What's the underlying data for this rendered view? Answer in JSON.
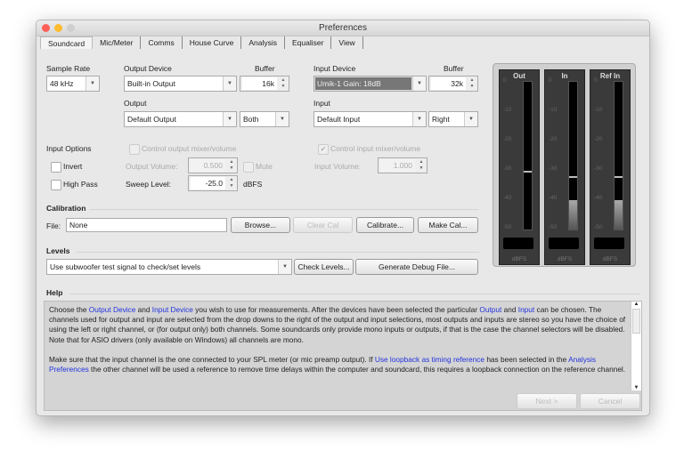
{
  "window": {
    "title": "Preferences"
  },
  "tabs": [
    "Soundcard",
    "Mic/Meter",
    "Comms",
    "House Curve",
    "Analysis",
    "Equaliser",
    "View"
  ],
  "soundcard": {
    "sample_rate_label": "Sample Rate",
    "sample_rate": "48 kHz",
    "output_device_label": "Output Device",
    "output_device": "Built-in Output",
    "buffer_label": "Buffer",
    "output_buffer": "16k",
    "input_device_label": "Input Device",
    "input_device": "Umik-1  Gain: 18dB",
    "input_buffer": "32k",
    "output_label": "Output",
    "output": "Default Output",
    "output_channel": "Both",
    "input_label": "Input",
    "input": "Default Input",
    "input_channel": "Right",
    "input_options_label": "Input Options",
    "invert_label": "Invert",
    "high_pass_label": "High Pass",
    "control_output_label": "Control output mixer/volume",
    "control_input_label": "Control input mixer/volume",
    "output_volume_label": "Output Volume:",
    "output_volume": "0.500",
    "mute_label": "Mute",
    "input_volume_label": "Input Volume:",
    "input_volume": "1.000",
    "sweep_level_label": "Sweep Level:",
    "sweep_level": "-25.0",
    "sweep_unit": "dBFS"
  },
  "calibration": {
    "title": "Calibration",
    "file_label": "File:",
    "file": "None",
    "browse": "Browse...",
    "clear": "Clear Cal",
    "calibrate": "Calibrate...",
    "make": "Make Cal..."
  },
  "levels": {
    "title": "Levels",
    "option": "Use subwoofer test signal to check/set levels",
    "check": "Check Levels...",
    "debug": "Generate Debug File..."
  },
  "meters": {
    "ticks": [
      "0",
      "-10",
      "-20",
      "-30",
      "-40",
      "-50"
    ],
    "unit": "dBFS",
    "items": [
      {
        "label": "Out",
        "peak_db": -30,
        "level_db": null
      },
      {
        "label": "In",
        "peak_db": -32,
        "level_db": -40
      },
      {
        "label": "Ref In",
        "peak_db": -32,
        "level_db": -40
      }
    ]
  },
  "help": {
    "title": "Help",
    "p1": [
      "Choose the ",
      "Output Device",
      " and ",
      "Input Device",
      " you wish to use for measurements. After the devices have been selected the particular ",
      "Output",
      " and ",
      "Input",
      " can be chosen. The channels used for output and input are selected from the drop downs to the right of the output and input selections, most outputs and inputs are stereo so you have the choice of using the left or right channel, or (for output only) both channels. Some soundcards only provide mono inputs or outputs, if that is the case the channel selectors will be disabled. Note that for ASIO drivers (only available on Windows) all channels are mono."
    ],
    "p2": [
      "Make sure that the input channel is the one connected to your SPL meter (or mic preamp output). If ",
      "Use loopback as timing reference",
      " has been selected in the ",
      "Analysis Preferences",
      " the other channel will be used a reference to remove time delays within the computer and soundcard, this requires a loopback connection on the reference channel."
    ]
  },
  "footer": {
    "next": "Next >",
    "cancel": "Cancel"
  }
}
